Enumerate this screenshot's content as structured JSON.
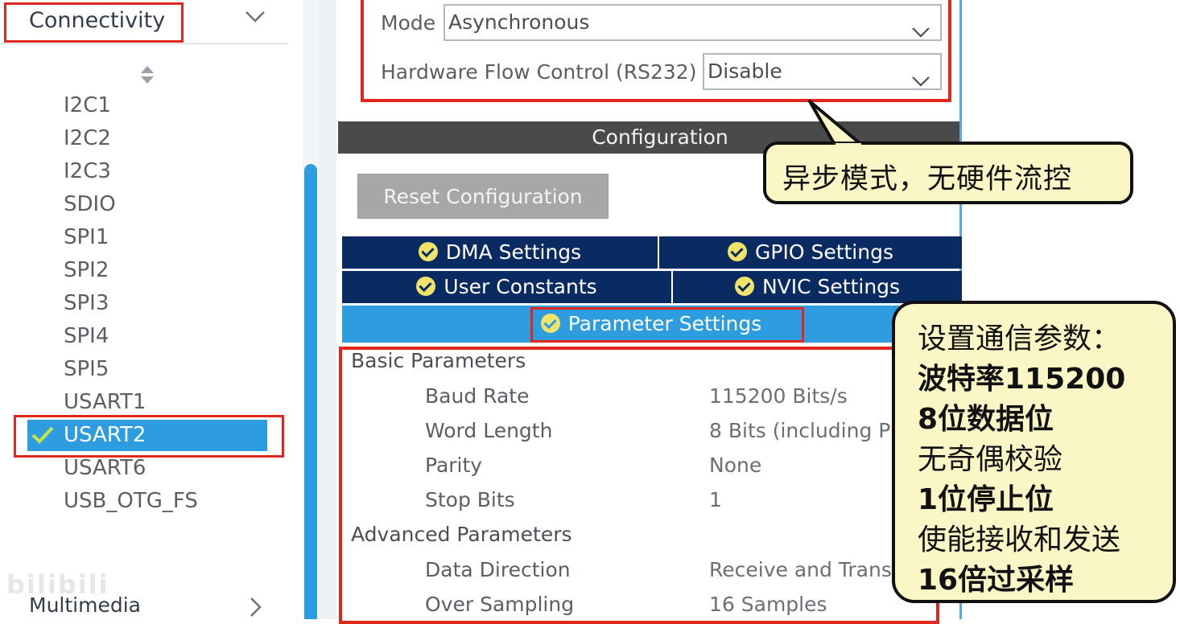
{
  "sidebar": {
    "category_label": "Connectivity",
    "items": [
      "I2C1",
      "I2C2",
      "I2C3",
      "SDIO",
      "SPI1",
      "SPI2",
      "SPI3",
      "SPI4",
      "SPI5",
      "USART1",
      "USART2",
      "USART6",
      "USB_OTG_FS"
    ],
    "selected_item": "USART2",
    "next_category_label": "Multimedia",
    "watermark": "bilibili"
  },
  "mode": {
    "mode_label": "Mode",
    "mode_value": "Asynchronous",
    "flow_label": "Hardware Flow Control (RS232)",
    "flow_value": "Disable"
  },
  "configuration": {
    "title": "Configuration",
    "reset_button": "Reset Configuration",
    "tabs": {
      "dma": "DMA Settings",
      "gpio": "GPIO Settings",
      "user_constants": "User Constants",
      "nvic": "NVIC Settings",
      "parameter": "Parameter Settings"
    },
    "basic_title": "Basic Parameters",
    "basic": [
      {
        "name": "Baud Rate",
        "value": "115200 Bits/s"
      },
      {
        "name": "Word Length",
        "value": "8 Bits (including P"
      },
      {
        "name": "Parity",
        "value": "None"
      },
      {
        "name": "Stop Bits",
        "value": "1"
      }
    ],
    "advanced_title": "Advanced Parameters",
    "advanced": [
      {
        "name": "Data Direction",
        "value": "Receive and Trans"
      },
      {
        "name": "Over Sampling",
        "value": "16 Samples"
      }
    ]
  },
  "callouts": {
    "mode_note": "异步模式，无硬件流控",
    "param_note": [
      "设置通信参数：",
      "波特率115200",
      "8位数据位",
      "无奇偶校验",
      "1位停止位",
      "使能接收和发送",
      "16倍过采样"
    ]
  },
  "colors": {
    "highlight_red": "#e0261d",
    "selected_blue": "#2e9de0",
    "tab_navy": "#0a2b61",
    "callout_fill": "#fbf6c6"
  }
}
